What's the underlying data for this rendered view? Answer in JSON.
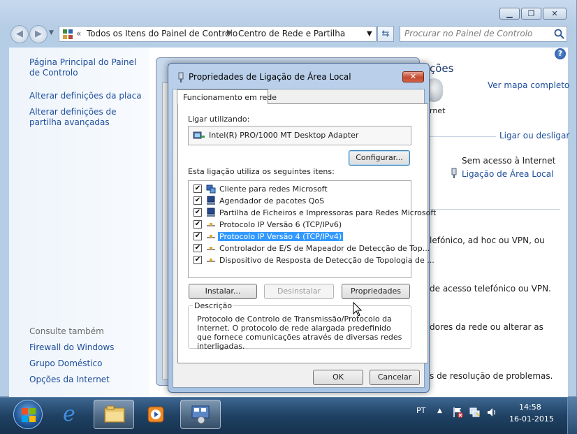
{
  "explorer": {
    "breadcrumb": [
      "Todos os Itens do Painel de Controlo",
      "Centro de Rede e Partilha"
    ],
    "search_placeholder": "Procurar no Painel de Controlo",
    "left_links": [
      "Página Principal do Painel de Controlo",
      "Alterar definições da placa",
      "Alterar definições de partilha avançadas"
    ],
    "see_also_heading": "Consulte também",
    "see_also_links": [
      "Firewall do Windows",
      "Grupo Doméstico",
      "Opções da Internet"
    ],
    "right_fragments": {
      "title_fragment": "ções",
      "view_map": "Ver mapa completo",
      "internet": "rnet",
      "connect_disconnect": "Ligar ou desligar",
      "no_internet": "Sem acesso à Internet",
      "local_connection": "Ligação de Área Local",
      "text1": "lefónico, ad hoc ou VPN, ou",
      "text2": "de acesso telefónico ou VPN.",
      "text3": "dores da rede ou alterar as",
      "text4": "s de resolução de problemas."
    }
  },
  "dialog": {
    "title": "Propriedades de Ligação de Área Local",
    "tab": "Funcionamento em rede",
    "connect_using_label": "Ligar utilizando:",
    "adapter": "Intel(R) PRO/1000 MT Desktop Adapter",
    "configure_button": "Configurar...",
    "items_label": "Esta ligação utiliza os seguintes itens:",
    "items": [
      {
        "label": "Cliente para redes Microsoft",
        "checked": "✔",
        "icon": "network-client-icon"
      },
      {
        "label": "Agendador de pacotes QoS",
        "checked": "✔",
        "icon": "network-service-icon"
      },
      {
        "label": "Partilha de Ficheiros e Impressoras para Redes Microsoft",
        "checked": "✔",
        "icon": "network-service-icon"
      },
      {
        "label": "Protocolo IP Versão 6 (TCP/IPv6)",
        "checked": "✔",
        "icon": "protocol-icon"
      },
      {
        "label": "Protocolo IP Versão 4 (TCP/IPv4)",
        "checked": "✔",
        "icon": "protocol-icon"
      },
      {
        "label": "Controlador de E/S de Mapeador de Detecção de Top...",
        "checked": "✔",
        "icon": "protocol-icon"
      },
      {
        "label": "Dispositivo de Resposta de Detecção de Topologia de ...",
        "checked": "✔",
        "icon": "protocol-icon"
      }
    ],
    "selected_item_index": 4,
    "install_button": "Instalar...",
    "uninstall_button": "Desinstalar",
    "properties_button": "Propriedades",
    "description_label": "Descrição",
    "description_text": "Protocolo de Controlo de Transmissão/Protocolo da Internet. O protocolo de rede alargada predefinido que fornece comunicações através de diversas redes interligadas.",
    "ok_button": "OK",
    "cancel_button": "Cancelar"
  },
  "taskbar": {
    "language": "PT",
    "time": "14:58",
    "date": "16-01-2015"
  },
  "colors": {
    "selection": "#3399ff",
    "link": "#1d4d9c",
    "taskbar": "#1f4163"
  }
}
